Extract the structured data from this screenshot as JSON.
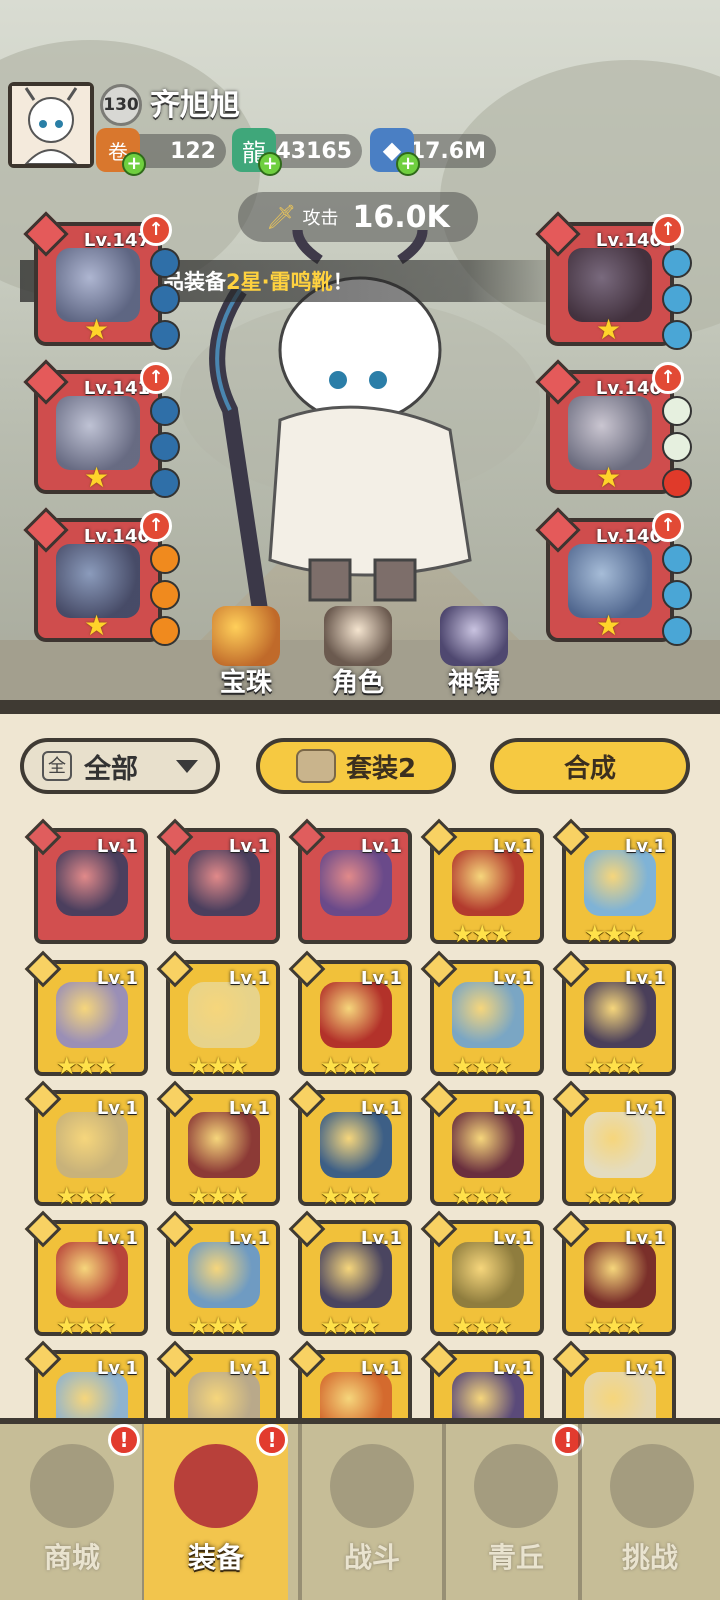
{
  "player": {
    "level": "130",
    "name": "齐旭旭"
  },
  "resources": [
    {
      "icon": "scroll-bag-icon",
      "value": "122"
    },
    {
      "icon": "jade-dragon-icon",
      "value": "43165"
    },
    {
      "icon": "crystal-icon",
      "value": "17.6M"
    }
  ],
  "power": {
    "label": "攻击",
    "value": "16.0K"
  },
  "notice": {
    "prefix": "合成出了极品装备 ",
    "highlight": "2星·雷鸣靴",
    "suffix": "！"
  },
  "equipped": {
    "left": [
      {
        "slot": "bow",
        "level": "Lv.147",
        "stars": "★",
        "gems": [
          "#2f6fa8",
          "#2f6fa8",
          "#2f6fa8"
        ]
      },
      {
        "slot": "helmet",
        "level": "Lv.141",
        "stars": "★",
        "gems": [
          "#2f6fa8",
          "#2f6fa8",
          "#2f6fa8"
        ]
      },
      {
        "slot": "bracer",
        "level": "Lv.140",
        "stars": "★",
        "gems": [
          "#f08a1e",
          "#f08a1e",
          "#f08a1e"
        ]
      }
    ],
    "right": [
      {
        "slot": "belt",
        "level": "Lv.140",
        "stars": "★",
        "gems": [
          "#4aa6d6",
          "#4aa6d6",
          "#4aa6d6"
        ]
      },
      {
        "slot": "boots",
        "level": "Lv.140",
        "stars": "★",
        "gems": [
          "#e6f0df",
          "#e6f0df",
          "#e03a2a"
        ]
      },
      {
        "slot": "amulet",
        "level": "Lv.140",
        "stars": "★",
        "gems": [
          "#4aa6d6",
          "#4aa6d6",
          "#4aa6d6"
        ]
      }
    ]
  },
  "menu": [
    {
      "icon": "pearl-chest-icon",
      "label": "宝珠"
    },
    {
      "icon": "character-icon",
      "label": "角色"
    },
    {
      "icon": "forge-icon",
      "label": "神铸"
    }
  ],
  "filter": {
    "chip": "全",
    "label": "全部"
  },
  "suit_button": "套装2",
  "compose_button": "合成",
  "bag": [
    {
      "rarity": "red",
      "level": "Lv.1",
      "stars": "",
      "art": "#4b3f5e"
    },
    {
      "rarity": "red",
      "level": "Lv.1",
      "stars": "",
      "art": "#4b3f5e"
    },
    {
      "rarity": "red",
      "level": "Lv.1",
      "stars": "",
      "art": "#6a4a8a"
    },
    {
      "rarity": "gold",
      "level": "Lv.1",
      "stars": "★★★",
      "art": "#b33b2e"
    },
    {
      "rarity": "gold",
      "level": "Lv.1",
      "stars": "★★★",
      "art": "#7fb3d6"
    },
    {
      "rarity": "gold",
      "level": "Lv.1",
      "stars": "★★★",
      "art": "#9a8fb6"
    },
    {
      "rarity": "gold",
      "level": "Lv.1",
      "stars": "★★★",
      "art": "#e7d38a"
    },
    {
      "rarity": "gold",
      "level": "Lv.1",
      "stars": "★★★",
      "art": "#b3322a"
    },
    {
      "rarity": "gold",
      "level": "Lv.1",
      "stars": "★★★",
      "art": "#7aa6c4"
    },
    {
      "rarity": "gold",
      "level": "Lv.1",
      "stars": "★★★",
      "art": "#4a3f5a"
    },
    {
      "rarity": "gold",
      "level": "Lv.1",
      "stars": "★★★",
      "art": "#c8b27a"
    },
    {
      "rarity": "gold",
      "level": "Lv.1",
      "stars": "★★★",
      "art": "#8c3a36"
    },
    {
      "rarity": "gold",
      "level": "Lv.1",
      "stars": "★★★",
      "art": "#3d5f86"
    },
    {
      "rarity": "gold",
      "level": "Lv.1",
      "stars": "★★★",
      "art": "#6a2f3e"
    },
    {
      "rarity": "gold",
      "level": "Lv.1",
      "stars": "★★★",
      "art": "#e4dcc0"
    },
    {
      "rarity": "gold",
      "level": "Lv.1",
      "stars": "★★★",
      "art": "#b8443a"
    },
    {
      "rarity": "gold",
      "level": "Lv.1",
      "stars": "★★★",
      "art": "#6f9bc2"
    },
    {
      "rarity": "gold",
      "level": "Lv.1",
      "stars": "★★★",
      "art": "#4a4560"
    },
    {
      "rarity": "gold",
      "level": "Lv.1",
      "stars": "★★★",
      "art": "#8f7d3e"
    },
    {
      "rarity": "gold",
      "level": "Lv.1",
      "stars": "★★★",
      "art": "#7a2f2a"
    },
    {
      "rarity": "gold",
      "level": "Lv.1",
      "stars": "",
      "art": "#8fb3cf"
    },
    {
      "rarity": "gold",
      "level": "Lv.1",
      "stars": "",
      "art": "#b9a98a"
    },
    {
      "rarity": "gold",
      "level": "Lv.1",
      "stars": "",
      "art": "#d46a2e"
    },
    {
      "rarity": "gold",
      "level": "Lv.1",
      "stars": "",
      "art": "#5a4a7a"
    },
    {
      "rarity": "gold",
      "level": "Lv.1",
      "stars": "",
      "art": "#e4d6b0"
    }
  ],
  "nav": [
    {
      "icon": "shop-icon",
      "label": "商城",
      "alert": "!",
      "active": false
    },
    {
      "icon": "equipment-icon",
      "label": "装备",
      "alert": "!",
      "active": true
    },
    {
      "icon": "battle-icon",
      "label": "战斗",
      "alert": "",
      "active": false
    },
    {
      "icon": "mountain-icon",
      "label": "青丘",
      "alert": "!",
      "active": false
    },
    {
      "icon": "challenge-icon",
      "label": "挑战",
      "alert": "",
      "active": false
    }
  ],
  "colors": {
    "equip_red": "#cf4d4d",
    "equip_gold": "#f1c13a",
    "button_yellow": "#f6c941",
    "nav_active": "#f2c54d",
    "panel_bg": "#efe6d2"
  }
}
